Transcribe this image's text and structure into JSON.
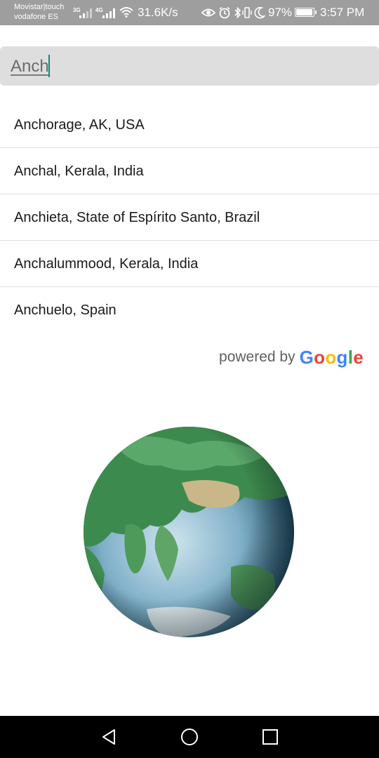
{
  "status_bar": {
    "carrier_1": "Movistar|touch",
    "carrier_2": "vodafone ES",
    "signal_1": "3G",
    "signal_2": "4G",
    "network_speed": "31.6K/s",
    "battery_percent": "97%",
    "battery_level": 0.97,
    "time": "3:57 PM",
    "icons": [
      "signal-icon",
      "wifi-icon",
      "eye-icon",
      "alarm-icon",
      "bluetooth-icon",
      "vibrate-icon",
      "moon-icon",
      "battery-icon"
    ]
  },
  "search": {
    "value": "Anch"
  },
  "suggestions": [
    {
      "label": "Anchorage, AK, USA"
    },
    {
      "label": "Anchal, Kerala, India"
    },
    {
      "label": "Anchieta, State of Espírito Santo, Brazil"
    },
    {
      "label": "Anchalummood, Kerala, India"
    },
    {
      "label": "Anchuelo, Spain"
    }
  ],
  "attribution": {
    "prefix": "powered by",
    "brand_letters": [
      "G",
      "o",
      "o",
      "g",
      "l",
      "e"
    ],
    "brand_colors": [
      "#4285f4",
      "#ea4335",
      "#fbbc05",
      "#4285f4",
      "#34a853",
      "#ea4335"
    ]
  },
  "navigation": {
    "icons": [
      "back-icon",
      "home-icon",
      "recents-icon"
    ]
  }
}
